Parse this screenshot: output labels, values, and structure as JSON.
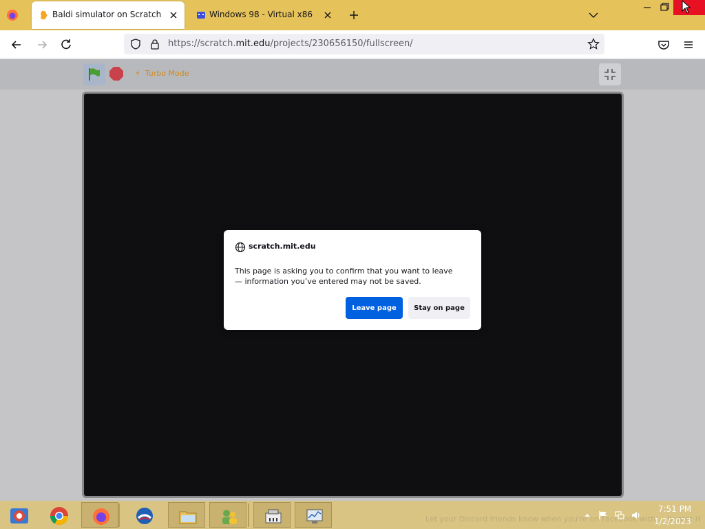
{
  "browser": {
    "tabs": [
      {
        "title": "Baldi simulator on Scratch",
        "active": true
      },
      {
        "title": "Windows 98 - Virtual x86",
        "active": false
      }
    ],
    "url": {
      "prefix": "https://scratch.",
      "host": "mit.edu",
      "path": "/projects/230656150/fullscreen/"
    }
  },
  "scratch": {
    "turbo_label": "Turbo Mode"
  },
  "dialog": {
    "host": "scratch.mit.edu",
    "message": "This page is asking you to confirm that you want to leave — information you’ve entered may not be saved.",
    "leave_label": "Leave page",
    "stay_label": "Stay on page"
  },
  "taskbar": {
    "notification_text": "Let your Discord friends know when you're on Facebook with ... hunter H",
    "time": "7:51 PM",
    "date": "1/2/2023"
  },
  "colors": {
    "tab_strip": "#e6c25a",
    "accent_button": "#0061e0",
    "taskbar": "#d9c483",
    "stage": "#0f0f11"
  }
}
